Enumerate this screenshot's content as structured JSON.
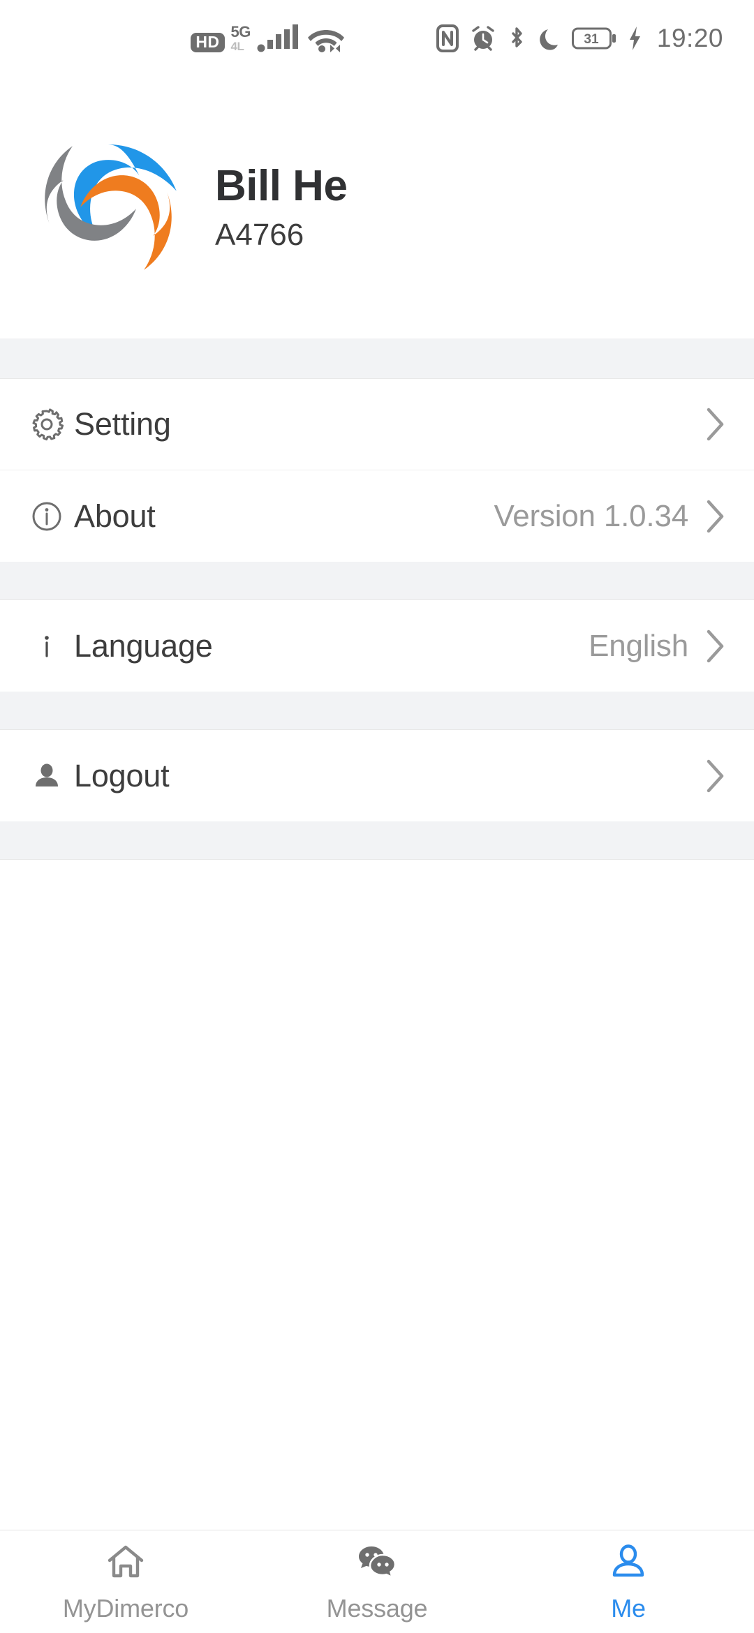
{
  "statusbar": {
    "hd_badge": "HD",
    "network_primary": "5G",
    "network_secondary": "4L",
    "battery_level": "31",
    "time": "19:20",
    "icons": [
      "hd-badge",
      "5g-icon",
      "signal-bars-icon",
      "wifi-icon",
      "nfc-icon",
      "alarm-icon",
      "bluetooth-icon",
      "do-not-disturb-moon-icon",
      "battery-icon",
      "charging-bolt-icon"
    ]
  },
  "profile": {
    "logo_icon": "dimerco-swirl-logo",
    "name": "Bill He",
    "code": "A4766",
    "colors": {
      "blue": "#2196e8",
      "orange": "#ef7c1f",
      "gray": "#808285"
    }
  },
  "menu": {
    "groups": [
      {
        "rows": [
          {
            "icon": "gear-icon",
            "label": "Setting",
            "value": ""
          },
          {
            "icon": "info-circle-icon",
            "label": "About",
            "value": "Version 1.0.34"
          }
        ]
      },
      {
        "rows": [
          {
            "icon": "info-i-icon",
            "label": "Language",
            "value": "English"
          }
        ]
      },
      {
        "rows": [
          {
            "icon": "person-icon",
            "label": "Logout",
            "value": ""
          }
        ]
      }
    ]
  },
  "tabbar": {
    "active_color": "#2b8ced",
    "inactive_color": "#949494",
    "tabs": [
      {
        "icon": "home-icon",
        "label": "MyDimerco",
        "active": false
      },
      {
        "icon": "chat-bubbles-icon",
        "label": "Message",
        "active": false
      },
      {
        "icon": "person-outline-icon",
        "label": "Me",
        "active": true
      }
    ]
  }
}
